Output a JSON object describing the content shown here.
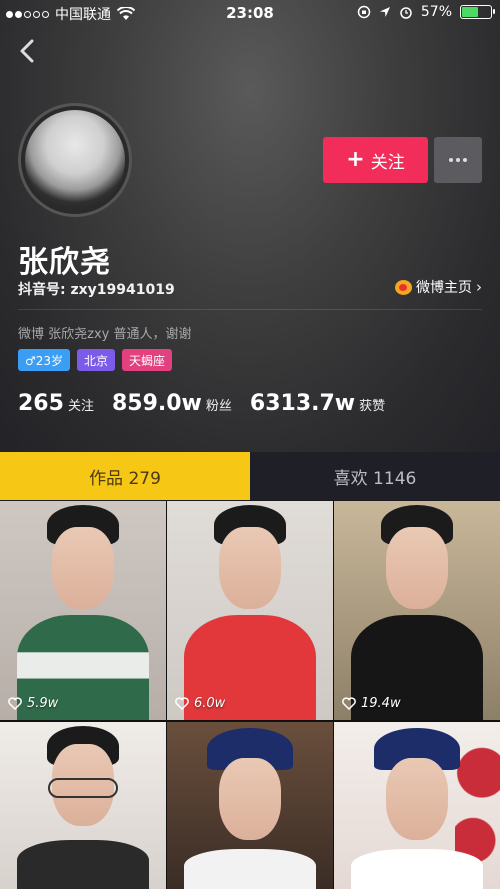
{
  "status_bar": {
    "carrier": "中国联通",
    "time": "23:08",
    "battery": "57%",
    "battery_level": 0.57
  },
  "profile": {
    "name": "张欣尧",
    "douyin_id": "抖音号: zxy19941019",
    "weibo_link": "微博主页",
    "bio": "微博 张欣尧zxy 普通人，谢谢",
    "tags": {
      "gender_age": "♂23岁",
      "city": "北京",
      "zodiac": "天蝎座"
    }
  },
  "actions": {
    "follow_label": "关注"
  },
  "stats": {
    "following": {
      "value": "265",
      "label": "关注"
    },
    "followers": {
      "value": "859.0w",
      "label": "粉丝"
    },
    "likes": {
      "value": "6313.7w",
      "label": "获赞"
    }
  },
  "tabs": {
    "works": "作品 279",
    "liked": "喜欢 1146"
  },
  "videos": [
    {
      "likes": "5.9w"
    },
    {
      "likes": "6.0w"
    },
    {
      "likes": "19.4w"
    },
    {
      "likes": ""
    },
    {
      "likes": ""
    },
    {
      "likes": ""
    }
  ],
  "colors": {
    "follow_button": "#f32d5a",
    "active_tab": "#f7c716",
    "gender_tag": "#3b9ef5",
    "city_tag": "#7b5be8",
    "zodiac_tag": "#e2407e"
  }
}
